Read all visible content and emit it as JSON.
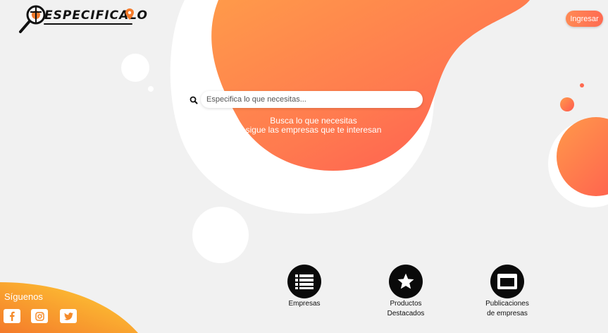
{
  "header": {
    "logo_text": "ESPECIFICALO",
    "login_label": "Ingresar"
  },
  "search": {
    "placeholder": "Especifica lo que necesitas...",
    "value": ""
  },
  "tagline": {
    "line1": "Busca lo que necesitas",
    "line2": "sigue las empresas que te interesan"
  },
  "follow": {
    "title": "Síguenos",
    "networks": [
      "facebook-icon",
      "instagram-icon",
      "twitter-icon"
    ]
  },
  "categories": [
    {
      "label": "Empresas",
      "icon": "list-icon"
    },
    {
      "label": "Productos\nDestacados",
      "icon": "star-icon"
    },
    {
      "label": "Publicaciones\nde empresas",
      "icon": "window-icon"
    }
  ],
  "colors": {
    "background": "#f1f1f1",
    "accent_orange": "#ff8a4d",
    "accent_red": "#ff5a4d",
    "gold": "#ffc03a",
    "social_orange": "#f58a28"
  }
}
